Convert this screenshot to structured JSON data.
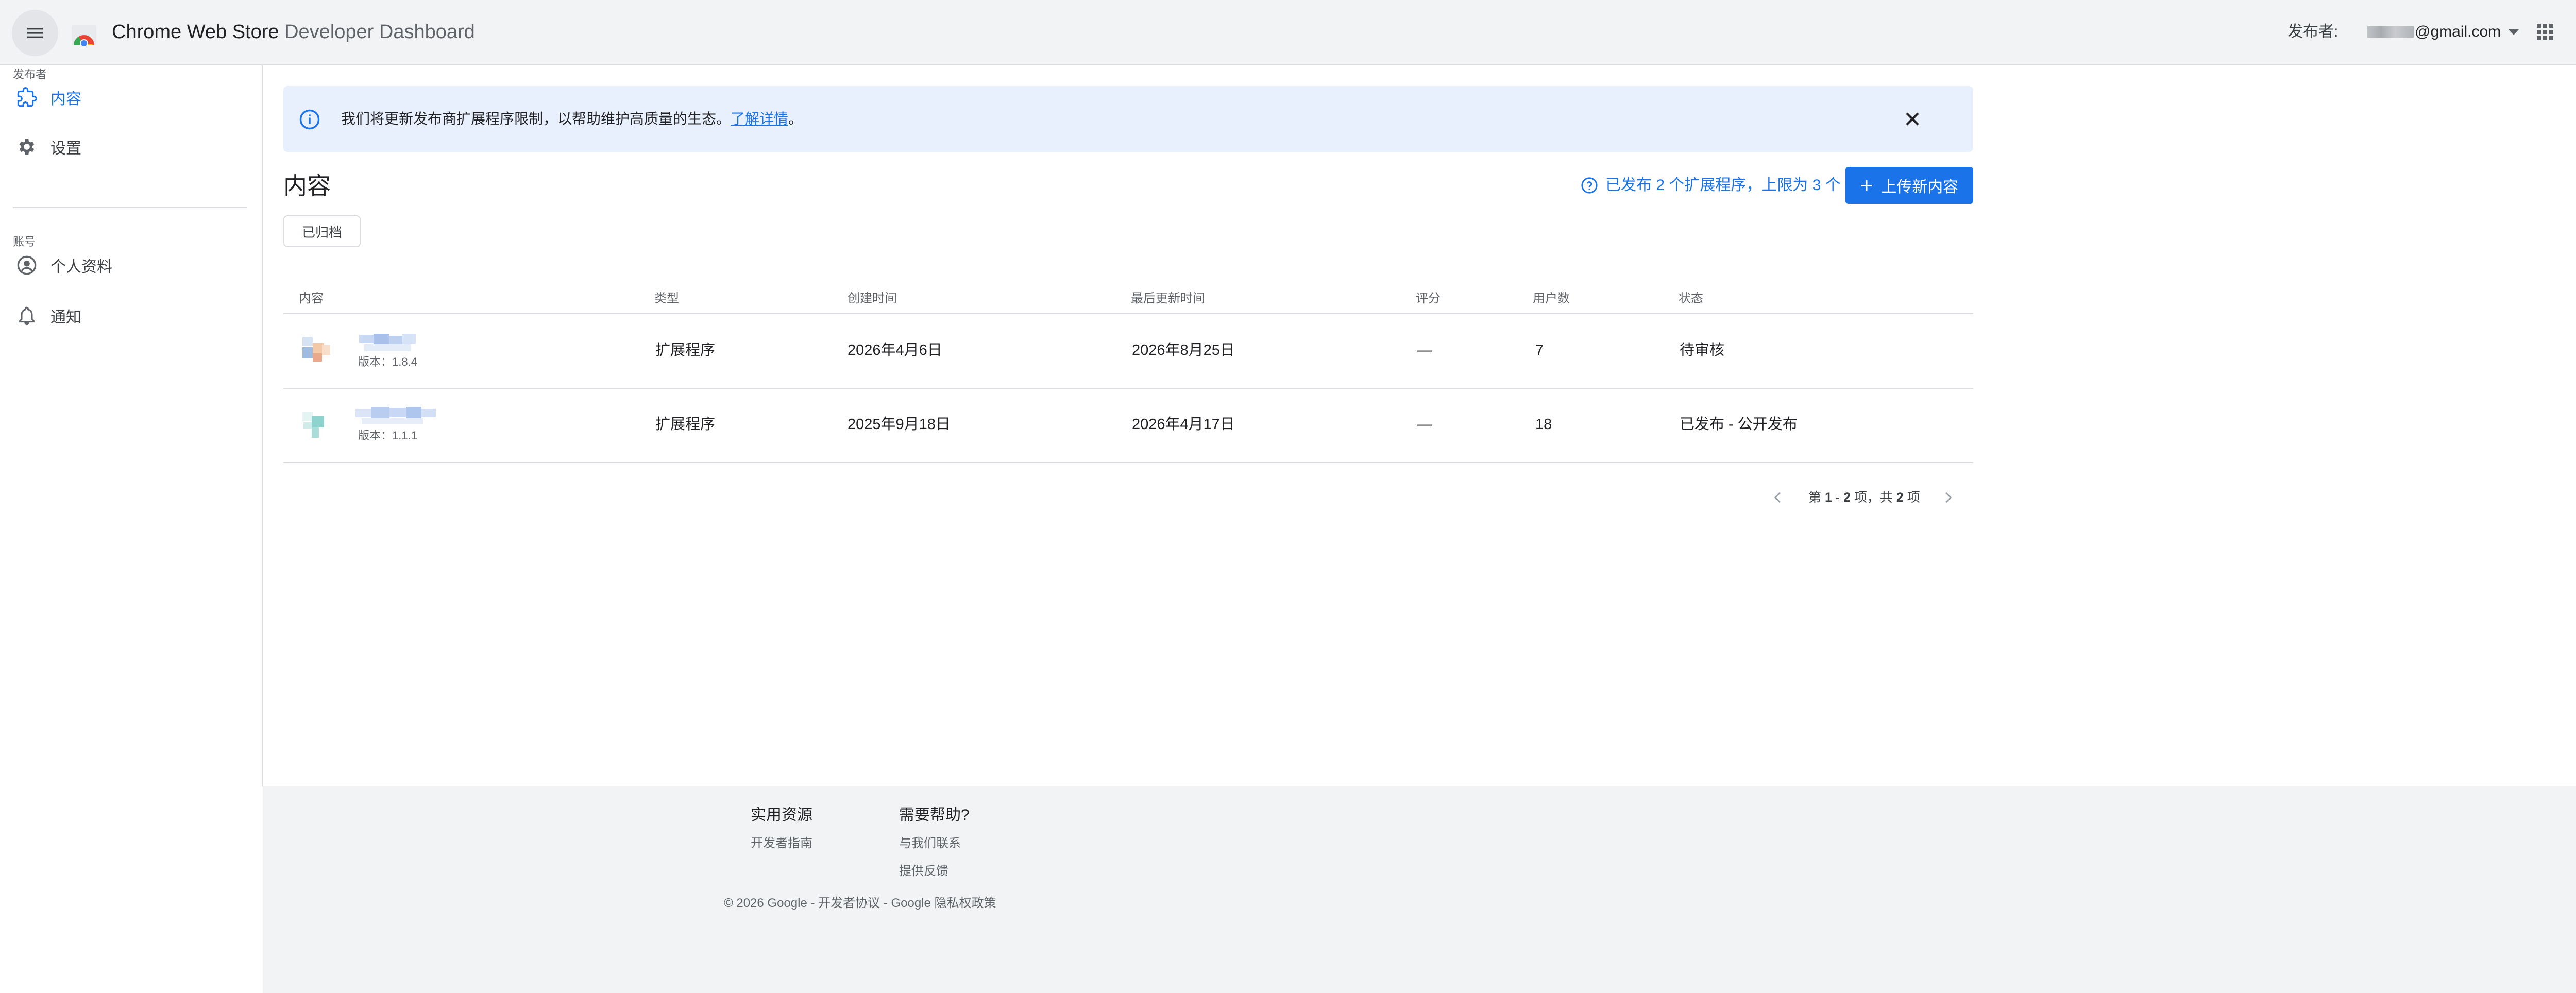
{
  "header": {
    "title_strong": "Chrome Web Store",
    "title_light": " Developer Dashboard",
    "publisher_label": "发布者:",
    "publisher_email": "@gmail.com"
  },
  "sidebar": {
    "section_publisher": "发布者",
    "items": [
      {
        "label": "内容",
        "icon": "puzzle-icon",
        "active": true
      },
      {
        "label": "设置",
        "icon": "gear-icon",
        "active": false
      }
    ],
    "section_account": "账号",
    "account_items": [
      {
        "label": "个人资料",
        "icon": "account-circle-icon"
      },
      {
        "label": "通知",
        "icon": "bell-icon"
      }
    ]
  },
  "banner": {
    "text": "我们将更新发布商扩展程序限制，以帮助维护高质量的生态。",
    "link": "了解详情",
    "suffix": "。"
  },
  "main": {
    "title": "内容",
    "quota": "已发布 2 个扩展程序，上限为 3 个",
    "upload_label": "上传新内容",
    "archived_label": "已归档"
  },
  "table": {
    "headers": [
      "内容",
      "类型",
      "创建时间",
      "最后更新时间",
      "评分",
      "用户数",
      "状态"
    ],
    "rows": [
      {
        "version": "版本：1.8.4",
        "type": "扩展程序",
        "created": "2026年4月6日",
        "updated": "2026年8月25日",
        "rating": "—",
        "users": "7",
        "status": "待审核"
      },
      {
        "version": "版本：1.1.1",
        "type": "扩展程序",
        "created": "2025年9月18日",
        "updated": "2026年4月17日",
        "rating": "—",
        "users": "18",
        "status": "已发布 - 公开发布"
      }
    ]
  },
  "pager": {
    "prefix": "第 ",
    "range": "1 - 2",
    "middle": " 项，共 ",
    "total": "2",
    "suffix": " 项"
  },
  "footer": {
    "resources_heading": "实用资源",
    "resources_links": [
      "开发者指南"
    ],
    "help_heading": "需要帮助?",
    "help_links": [
      "与我们联系",
      "提供反馈"
    ],
    "copyright": "© 2026 Google - 开发者协议 - Google 隐私权政策"
  },
  "colors": {
    "accent": "#1a73e8",
    "banner_bg": "#e8f0fe",
    "topbar_bg": "#f1f3f4"
  }
}
